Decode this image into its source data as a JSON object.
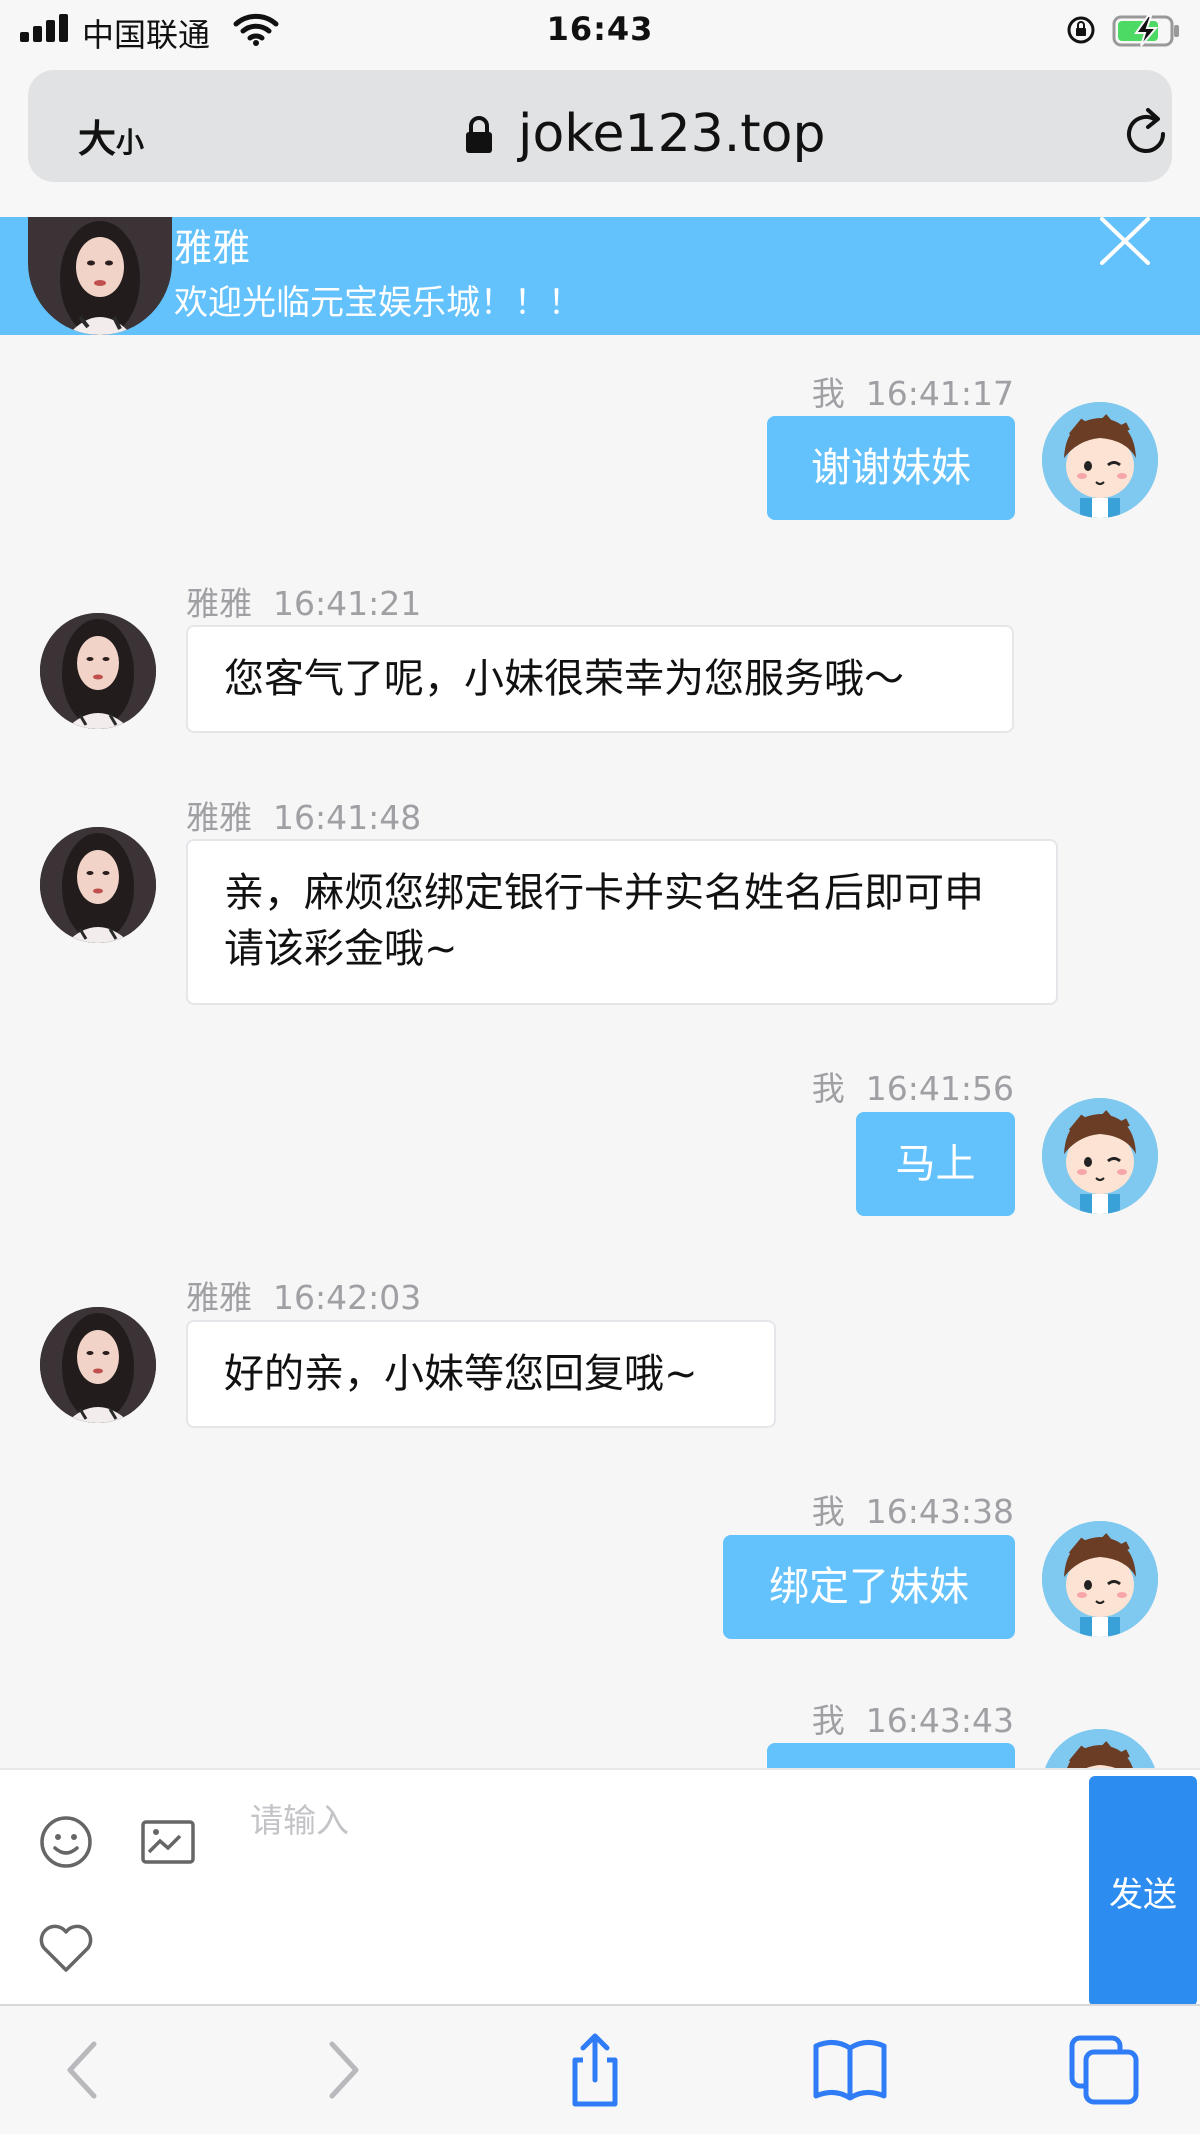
{
  "status_bar": {
    "carrier": "中国联通",
    "time": "16:43"
  },
  "browser": {
    "text_size_label": "大",
    "text_size_small": "小",
    "url": "joke123.top"
  },
  "agent": {
    "name": "雅雅",
    "greeting": "欢迎光临元宝娱乐城！！！"
  },
  "messages": [
    {
      "sender": "我",
      "time": "16:41:17",
      "direction": "out",
      "text": "谢谢妹妹"
    },
    {
      "sender": "雅雅",
      "time": "16:41:21",
      "direction": "in",
      "text": "您客气了呢，小妹很荣幸为您服务哦～"
    },
    {
      "sender": "雅雅",
      "time": "16:41:48",
      "direction": "in",
      "text": "亲，麻烦您绑定银行卡并实名姓名后即可申请该彩金哦~"
    },
    {
      "sender": "我",
      "time": "16:41:56",
      "direction": "out",
      "text": "马上"
    },
    {
      "sender": "雅雅",
      "time": "16:42:03",
      "direction": "in",
      "text": "好的亲，小妹等您回复哦~"
    },
    {
      "sender": "我",
      "time": "16:43:38",
      "direction": "out",
      "text": "绑定了妹妹"
    },
    {
      "sender": "我",
      "time": "16:43:43",
      "direction": "out",
      "text": ""
    }
  ],
  "input": {
    "placeholder": "请输入",
    "send_label": "发送"
  },
  "icons": {
    "emoji": "smile-icon",
    "image": "image-icon",
    "favorite": "heart-icon",
    "back": "chevron-left-icon",
    "forward": "chevron-right-icon",
    "share": "share-icon",
    "bookmarks": "book-icon",
    "tabs": "tabs-icon"
  },
  "colors": {
    "accent_blue": "#63c1fc",
    "send_blue": "#2d8cf0",
    "safari_blue": "#2f7cf6"
  }
}
